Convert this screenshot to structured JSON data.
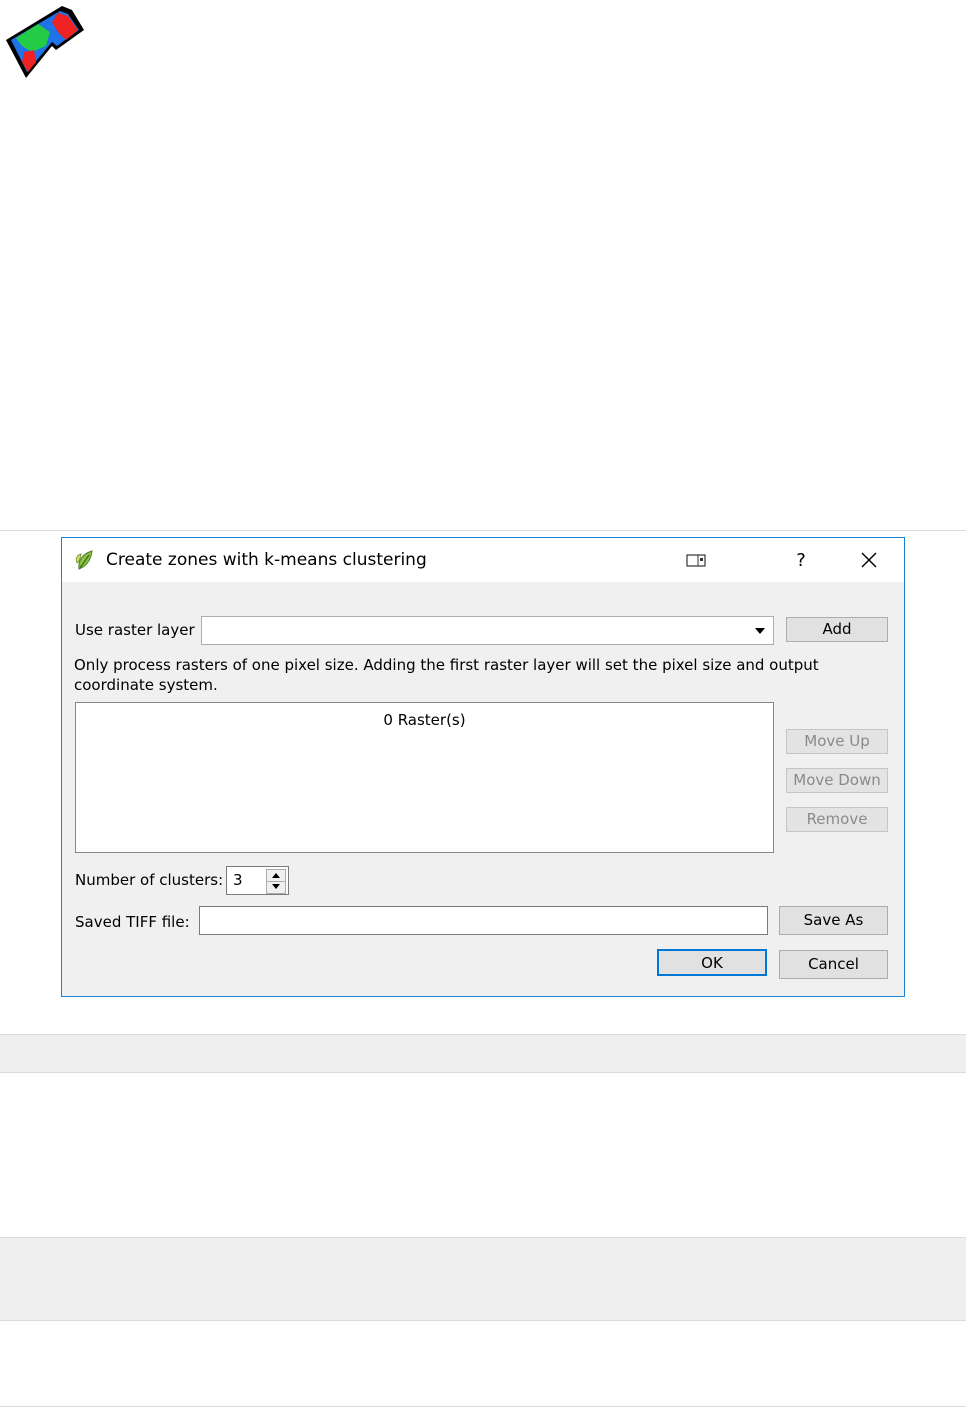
{
  "dialog": {
    "title": "Create zones with k-means clustering",
    "help_label": "?",
    "use_raster_label": "Use raster layer",
    "use_raster_value": "",
    "add_label": "Add",
    "info_text": "Only process rasters of one pixel size. Adding the first raster layer will set the pixel size and output coordinate system.",
    "raster_list_caption": "0 Raster(s)",
    "move_up_label": "Move Up",
    "move_down_label": "Move Down",
    "remove_label": "Remove",
    "clusters_label": "Number of clusters:",
    "clusters_value": "3",
    "tiff_label": "Saved TIFF file:",
    "tiff_value": "",
    "save_as_label": "Save As",
    "ok_label": "OK",
    "cancel_label": "Cancel"
  },
  "icons": {
    "app_logo": "zones-logo-icon",
    "title_icon": "qgis-leaf-icon",
    "keyboard": "keyboard-icon",
    "close": "close-icon",
    "dropdown": "chevron-down-icon",
    "spin_up": "spin-up-icon",
    "spin_down": "spin-down-icon"
  },
  "colors": {
    "accent": "#0078d7",
    "dialog_border": "#1883d7",
    "dialog_bg": "#f0f0f0",
    "logo_blue": "#1e73e8",
    "logo_green": "#22cc44",
    "logo_red": "#ee2222"
  }
}
